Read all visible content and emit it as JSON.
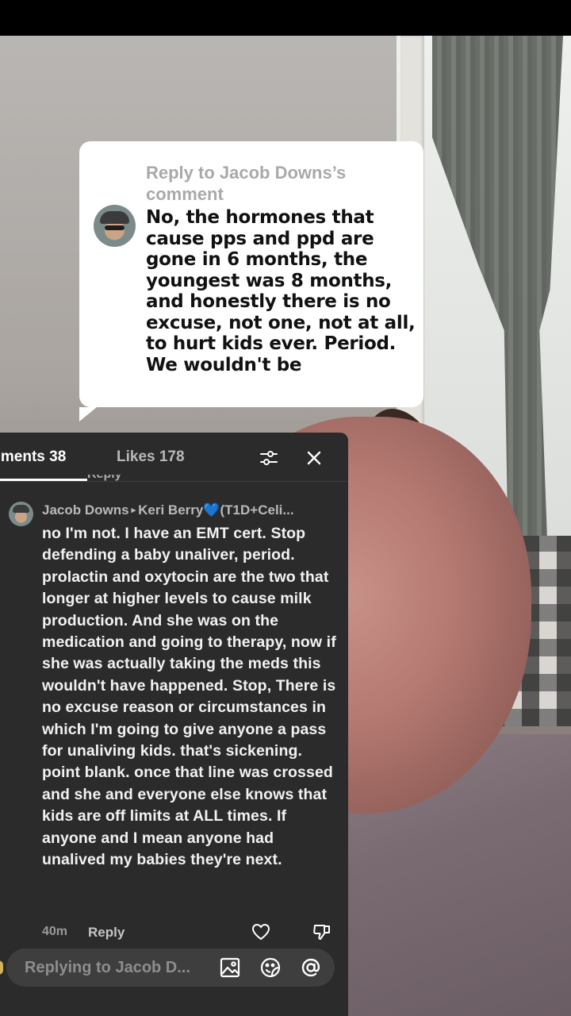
{
  "reply_sticker": {
    "header": "Reply to Jacob Downs’s comment",
    "body": "No, the hormones that cause pps and ppd are gone in 6 months, the youngest was 8 months, and honestly there is no excuse, not one, not at all, to hurt kids ever. Period. We wouldn't be",
    "avatar_icon": "user-avatar"
  },
  "comments_panel": {
    "tabs": [
      {
        "label": "mments 38",
        "active": true
      },
      {
        "label": "Likes 178",
        "active": false
      }
    ],
    "filter_icon": "sliders-icon",
    "close_icon": "close-icon",
    "peek_reply_label": "Reply",
    "comment": {
      "author": "Jacob Downs",
      "reply_to": "Keri Berry",
      "reply_to_suffix": "(T1D+Celi...",
      "heart_emoji": "💙",
      "text": "no I'm not. I have an EMT cert. Stop defending a baby unaliver, period. prolactin and oxytocin are the two that longer at higher levels to cause milk production. And she was on the medication and going to therapy, now if she was actually taking the meds this wouldn't have happened. Stop, There is no excuse reason or circumstances in which I'm going to give anyone a pass for unaliving kids. that's sickening. point blank. once that line was crossed and she and everyone else knows that kids are off limits at ALL times. If anyone and I mean anyone had unalived my babies they're next.",
      "time": "40m",
      "reply_label": "Reply"
    },
    "input": {
      "placeholder": "Replying to Jacob D...",
      "icons": [
        "image-icon",
        "emoji-icon",
        "mention-icon"
      ]
    }
  },
  "colors": {
    "panel_bg": "#2b2b2b",
    "sticker_bg": "#ffffff",
    "accent_heart": "#3d8cf0"
  }
}
